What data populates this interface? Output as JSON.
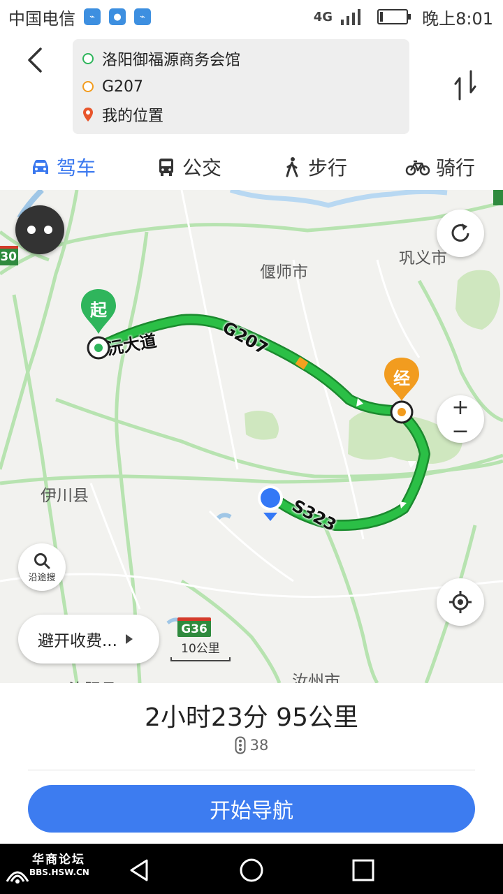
{
  "status_bar": {
    "carrier": "中国电信",
    "network": "4G",
    "time": "晚上8:01"
  },
  "route": {
    "origin": "洛阳御福源商务会馆",
    "waypoint": "G207",
    "destination": "我的位置"
  },
  "tabs": [
    {
      "label": "驾车",
      "icon": "car-icon",
      "active": true
    },
    {
      "label": "公交",
      "icon": "bus-icon",
      "active": false
    },
    {
      "label": "步行",
      "icon": "walk-icon",
      "active": false
    },
    {
      "label": "骑行",
      "icon": "bike-icon",
      "active": false
    }
  ],
  "map": {
    "places": {
      "yanshi": "偃师市",
      "gongyi": "巩义市",
      "yichuan": "伊川县",
      "ruzhou": "汝州市",
      "ruyang": "汝阳县",
      "left_badge": "30"
    },
    "road_labels": {
      "avenue": "沅大道",
      "g207": "G207",
      "s323": "S323",
      "g36": "G36"
    },
    "markers": {
      "start": "起",
      "via": "经"
    },
    "search_along_label": "沿途搜",
    "avoid_toll_label": "避开收费...",
    "scale_label": "10公里",
    "zoom_in": "+",
    "zoom_out": "−"
  },
  "summary": {
    "duration_distance": "2小时23分  95公里",
    "traffic_lights": "38"
  },
  "start_navigation_label": "开始导航",
  "watermark": {
    "name": "华商论坛",
    "url": "BBS.HSW.CN"
  },
  "colors": {
    "accent": "#3d7cf0",
    "route": "#2bbf46",
    "start_marker": "#2fb55c",
    "via_marker": "#f29c1f",
    "location": "#3478f6"
  }
}
